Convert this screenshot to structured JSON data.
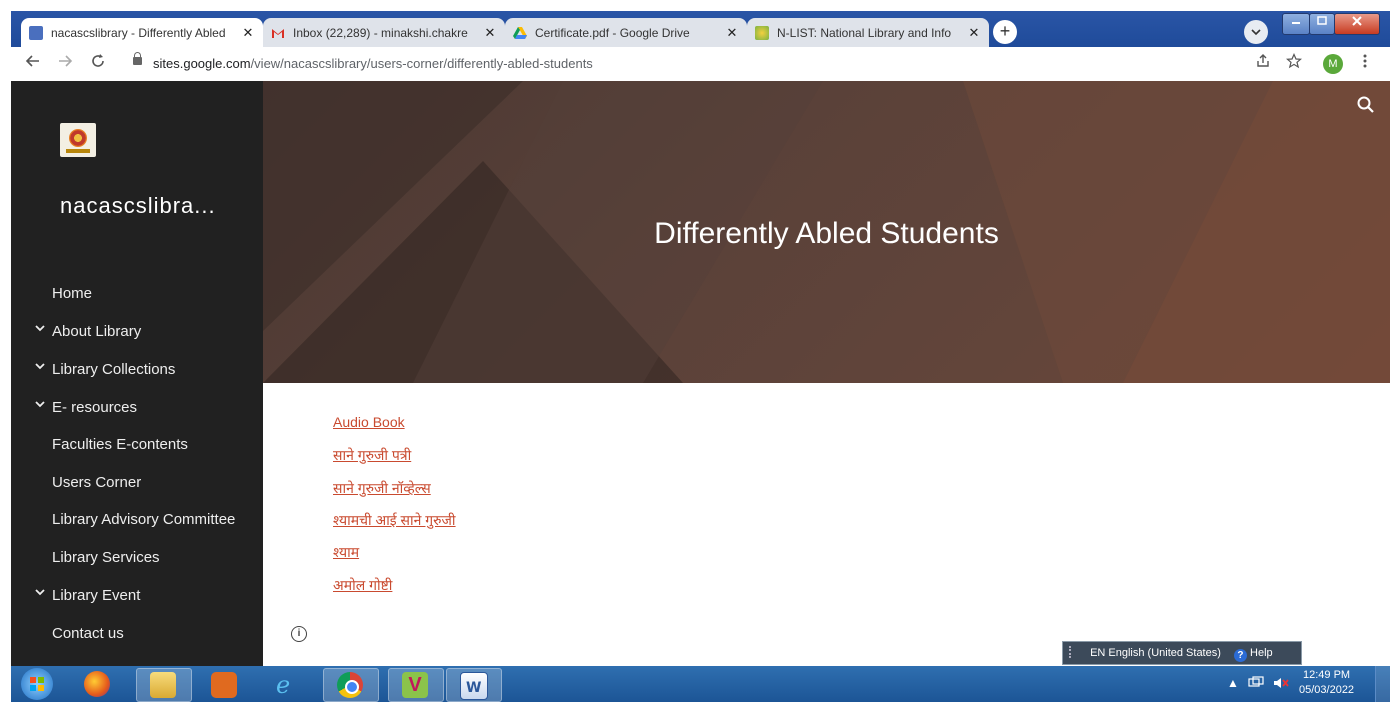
{
  "browser": {
    "tabs": [
      {
        "label": "nacascslibrary - Differently Abled",
        "icon": "google-sites-icon",
        "active": true
      },
      {
        "label": "Inbox (22,289) - minakshi.chakre",
        "icon": "gmail-icon",
        "active": false
      },
      {
        "label": "Certificate.pdf - Google Drive",
        "icon": "google-drive-icon",
        "active": false
      },
      {
        "label": "N-LIST: National Library and Info",
        "icon": "nlist-icon",
        "active": false
      }
    ],
    "close_glyph": "✕",
    "new_tab_glyph": "+",
    "url_host": "sites.google.com",
    "url_path": "/view/nacascslibrary/users-corner/differently-abled-students",
    "profile_initial": "M"
  },
  "sidebar": {
    "site_name": "nacascslibra...",
    "items": [
      {
        "label": "Home",
        "expandable": false
      },
      {
        "label": "About Library",
        "expandable": true
      },
      {
        "label": "Library Collections",
        "expandable": true
      },
      {
        "label": "E- resources",
        "expandable": true
      },
      {
        "label": "Faculties E-contents",
        "expandable": false
      },
      {
        "label": "Users Corner",
        "expandable": false
      },
      {
        "label": "Library Advisory Committee",
        "expandable": false
      },
      {
        "label": "Library Services",
        "expandable": false
      },
      {
        "label": "Library Event",
        "expandable": true
      },
      {
        "label": "Contact us",
        "expandable": false
      }
    ]
  },
  "hero": {
    "title": "Differently Abled Students"
  },
  "content": {
    "links": [
      "Audio Book ",
      "साने गुरुजी पत्री ",
      "साने गुरुजी नॉव्हेल्स ",
      "श्यामची आई साने गुरुजी ",
      "श्याम ",
      "अमोल गोष्टी "
    ]
  },
  "language_bar": {
    "language": "EN English (United States)",
    "help": "Help"
  },
  "taskbar": {
    "time": "12:49 PM",
    "date": "05/03/2022"
  },
  "colors": {
    "link": "#c94a2f",
    "sidebar_bg": "#212121",
    "hero_bg": "#5a4139",
    "tabstrip": "#1f4b9a"
  }
}
